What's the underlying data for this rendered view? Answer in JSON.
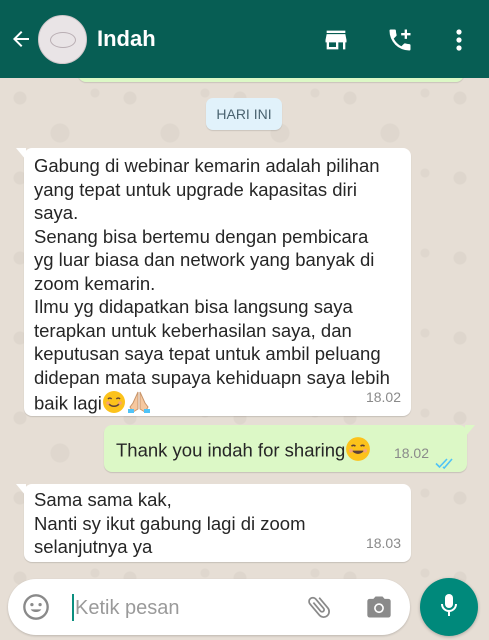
{
  "header": {
    "contact_name": "Indah",
    "icons": [
      "back-arrow-icon",
      "store-icon",
      "add-call-icon",
      "more-vert-icon"
    ]
  },
  "date_chip": "HARI INI",
  "messages": [
    {
      "direction": "incoming",
      "text": "Gabung di webinar kemarin adalah pilihan\nyang tepat untuk upgrade kapasitas diri\nsaya.\nSenang bisa bertemu dengan pembicara\nyg luar biasa dan network yang banyak di\nzoom kemarin.\nIlmu yg didapatkan bisa langsung saya\nterapkan untuk keberhasilan saya, dan\nkeputusan saya tepat untuk ambil peluang\ndidepan mata supaya kehiduapn saya lebih\nbaik lagi",
      "emojis": [
        "smiling-face-icon",
        "folded-hands-icon"
      ],
      "time": "18.02"
    },
    {
      "direction": "outgoing",
      "text": "Thank you indah for sharing",
      "emojis": [
        "smiling-face-icon"
      ],
      "time": "18.02",
      "status": "read"
    },
    {
      "direction": "incoming",
      "text": "Sama sama kak,\nNanti sy ikut gabung lagi di zoom\nselanjutnya ya",
      "time": "18.03"
    }
  ],
  "composer": {
    "placeholder": "Ketik pesan",
    "value": ""
  },
  "colors": {
    "header": "#075e54",
    "outgoing_bubble": "#dcf8c6",
    "incoming_bubble": "#ffffff",
    "mic_button": "#00897b",
    "read_ticks": "#4fc3f7"
  }
}
